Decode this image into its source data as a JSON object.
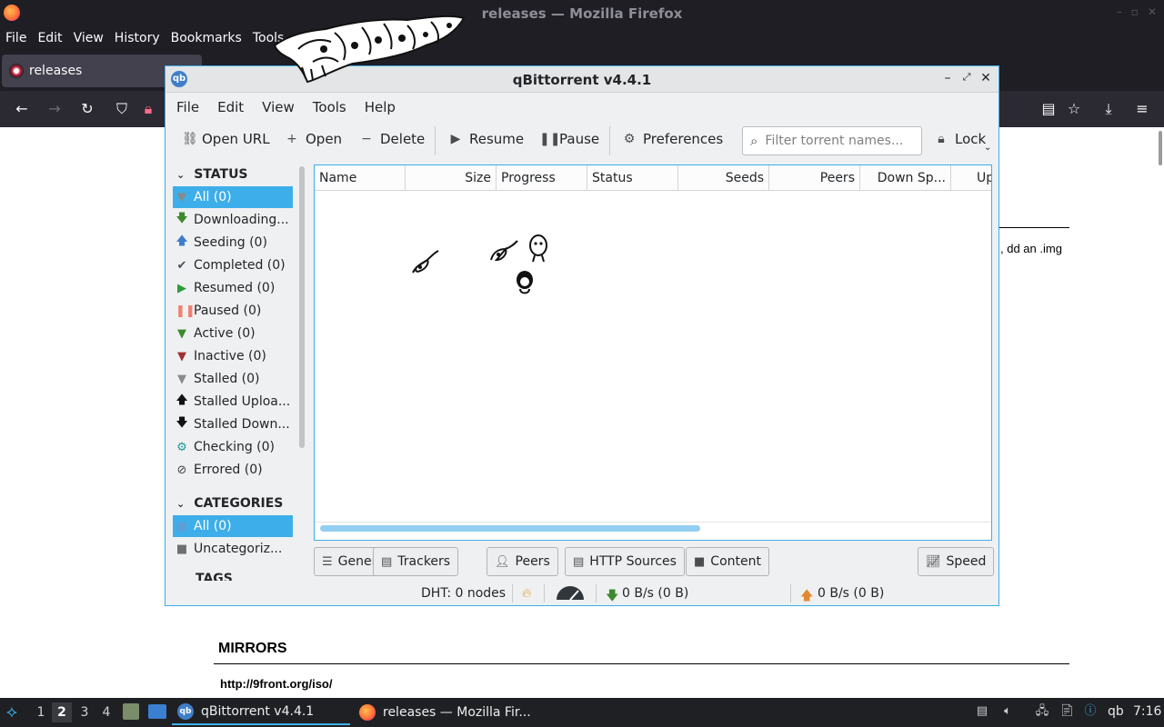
{
  "firefox": {
    "window_title": "releases — Mozilla Firefox",
    "menu": [
      "File",
      "Edit",
      "View",
      "History",
      "Bookmarks",
      "Tools"
    ],
    "tab_title": "releases",
    "page": {
      "snippet": ", dd an .img",
      "mirrors_heading": "MIRRORS",
      "mirror_link": "http://9front.org/iso/"
    }
  },
  "qbittorrent": {
    "window_title": "qBittorrent v4.4.1",
    "menu": [
      "File",
      "Edit",
      "View",
      "Tools",
      "Help"
    ],
    "toolbar": {
      "open_url": "Open URL",
      "open": "Open",
      "delete": "Delete",
      "resume": "Resume",
      "pause": "Pause",
      "preferences": "Preferences",
      "filter_placeholder": "Filter torrent names...",
      "lock": "Lock"
    },
    "sidebar": {
      "status_header": "STATUS",
      "status_items": [
        {
          "label": "All (0)",
          "icon": "filter-icon",
          "color": "#8a8a8a",
          "selected": true
        },
        {
          "label": "Downloading...",
          "icon": "arrow-down-icon",
          "color": "#3c8a2e"
        },
        {
          "label": "Seeding (0)",
          "icon": "arrow-up-icon",
          "color": "#3f7fc9"
        },
        {
          "label": "Completed (0)",
          "icon": "checkmark-icon",
          "color": "#44505c"
        },
        {
          "label": "Resumed (0)",
          "icon": "play-icon",
          "color": "#2e9a3a"
        },
        {
          "label": "Paused (0)",
          "icon": "pause-icon",
          "color": "#f08070"
        },
        {
          "label": "Active (0)",
          "icon": "filter-icon",
          "color": "#3c8a2e"
        },
        {
          "label": "Inactive (0)",
          "icon": "filter-icon",
          "color": "#a03030"
        },
        {
          "label": "Stalled (0)",
          "icon": "filter-icon",
          "color": "#8a8a8a"
        },
        {
          "label": "Stalled Uploa...",
          "icon": "arrow-up-icon",
          "color": "#111111"
        },
        {
          "label": "Stalled Down...",
          "icon": "arrow-down-icon",
          "color": "#111111"
        },
        {
          "label": "Checking (0)",
          "icon": "gear-icon",
          "color": "#1f9b9b"
        },
        {
          "label": "Errored (0)",
          "icon": "error-icon",
          "color": "#444444"
        }
      ],
      "categories_header": "CATEGORIES",
      "category_items": [
        {
          "label": "All (0)",
          "icon": "folder-icon",
          "selected": true
        },
        {
          "label": "Uncategoriz...",
          "icon": "folder-icon"
        }
      ],
      "tags_header": "TAGS"
    },
    "columns": [
      "Name",
      "Size",
      "Progress",
      "Status",
      "Seeds",
      "Peers",
      "Down Sp...",
      "Up"
    ],
    "bottom_tabs": {
      "general": "General",
      "trackers": "Trackers",
      "peers": "Peers",
      "http_sources": "HTTP Sources",
      "content": "Content",
      "speed": "Speed"
    },
    "statusbar": {
      "dht": "DHT: 0 nodes",
      "download": "0 B/s (0 B)",
      "upload": "0 B/s (0 B)"
    }
  },
  "taskbar": {
    "workspaces": [
      "1",
      "2",
      "3",
      "4"
    ],
    "current_workspace": "2",
    "tasks": [
      {
        "label": "qBittorrent v4.4.1",
        "active": true
      },
      {
        "label": "releases — Mozilla Fir...",
        "active": false
      }
    ],
    "tray_text": "qb",
    "clock": "7:16"
  },
  "colors": {
    "accent": "#3daee9",
    "firefox_dark": "#1f1e25",
    "taskbar": "#1f2023"
  }
}
